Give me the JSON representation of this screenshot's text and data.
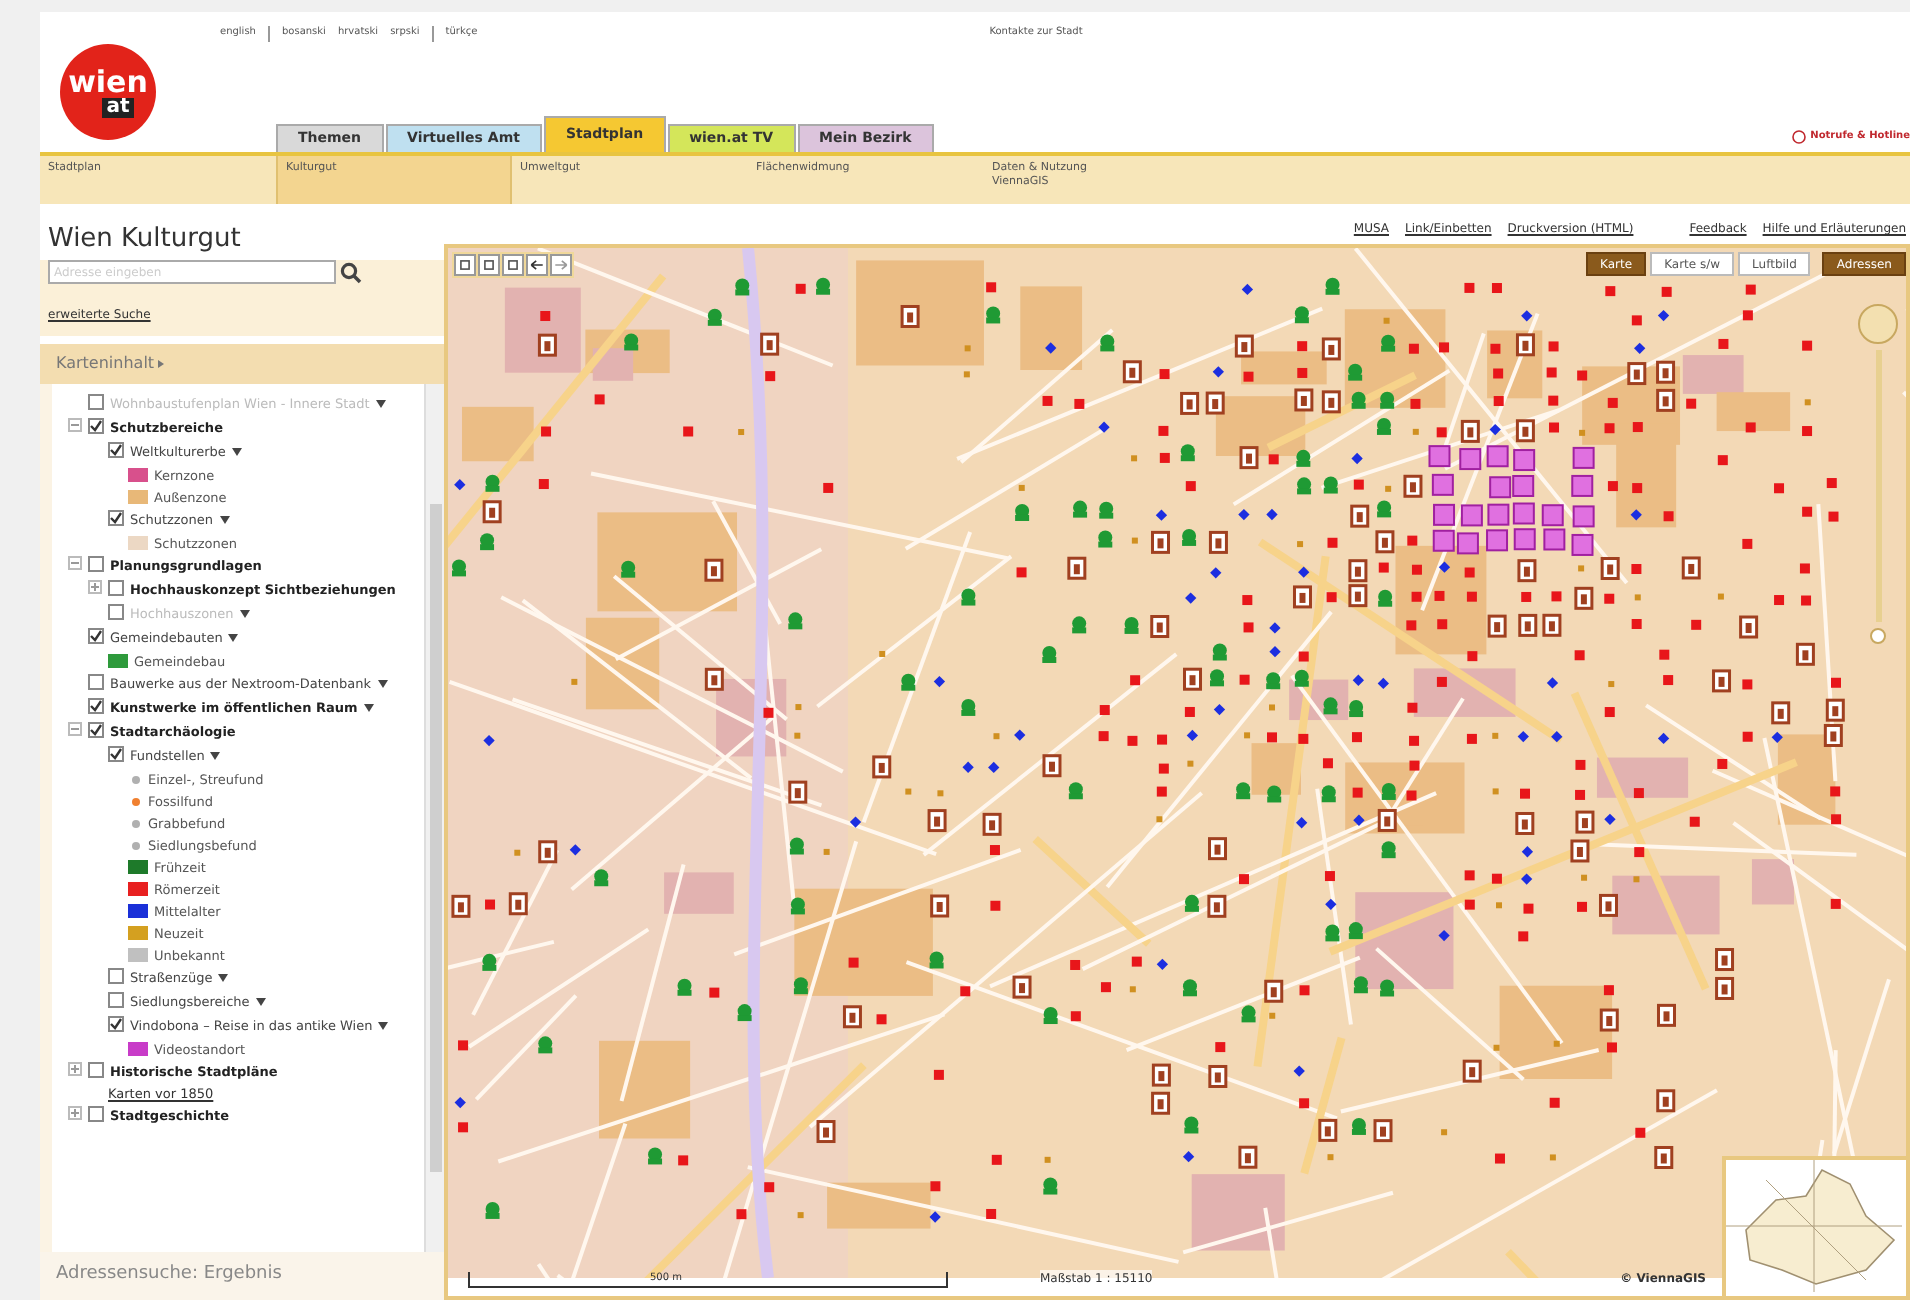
{
  "languages": [
    "english",
    "bosanski",
    "hrvatski",
    "srpski",
    "türkçe"
  ],
  "top_link": "Kontakte zur Stadt",
  "emergency_link": "Notrufe & Hotline",
  "logo": {
    "line1": "wien",
    "line2": "at"
  },
  "tabs": [
    {
      "label": "Themen",
      "color": "#d9d9d9",
      "selected": false
    },
    {
      "label": "Virtuelles Amt",
      "color": "#bfe0f0",
      "selected": false
    },
    {
      "label": "Stadtplan",
      "color": "#f5c832",
      "selected": true
    },
    {
      "label": "wien.at TV",
      "color": "#d4e65a",
      "selected": false
    },
    {
      "label": "Mein Bezirk",
      "color": "#dcc4dc",
      "selected": false
    }
  ],
  "subnav": [
    {
      "lines": [
        "Stadtplan"
      ],
      "selected": false
    },
    {
      "lines": [
        "Kulturgut"
      ],
      "selected": true
    },
    {
      "lines": [
        "Umweltgut"
      ],
      "selected": false
    },
    {
      "lines": [
        "Flächenwidmung"
      ],
      "selected": false
    },
    {
      "lines": [
        "Daten & Nutzung",
        "ViennaGIS"
      ],
      "selected": false
    }
  ],
  "page_title": "Wien Kulturgut",
  "search": {
    "placeholder": "Adresse eingeben",
    "advanced_link": "erweiterte Suche"
  },
  "links": [
    "MUSA",
    "Link/Einbetten",
    "Druckversion (HTML)",
    "Feedback",
    "Hilfe und Erläuterungen"
  ],
  "panel_title": "Karteninhalt",
  "tree": [
    {
      "kind": "layer",
      "label": "Wohnbaustufenplan Wien - Innere Stadt",
      "checked": false,
      "disabled": true,
      "menu": true
    },
    {
      "kind": "group",
      "label": "Schutzbereiche",
      "checked": true,
      "expanded": true,
      "children": [
        {
          "kind": "layer",
          "label": "Weltkulturerbe",
          "checked": true,
          "menu": true,
          "children": [
            {
              "kind": "swatch",
              "label": "Kernzone",
              "color": "#d8508c"
            },
            {
              "kind": "swatch",
              "label": "Außenzone",
              "color": "#e8b878"
            }
          ]
        },
        {
          "kind": "layer",
          "label": "Schutzzonen",
          "checked": true,
          "menu": true,
          "children": [
            {
              "kind": "swatch",
              "label": "Schutzzonen",
              "color": "#ecd8c4"
            }
          ]
        }
      ]
    },
    {
      "kind": "group",
      "label": "Planungsgrundlagen",
      "checked": false,
      "expanded": true,
      "children": [
        {
          "kind": "group",
          "label": "Hochhauskonzept Sichtbeziehungen",
          "checked": false,
          "expanded": false
        },
        {
          "kind": "layer",
          "label": "Hochhauszonen",
          "checked": false,
          "disabled": true,
          "menu": true
        }
      ]
    },
    {
      "kind": "layer",
      "label": "Gemeindebauten",
      "checked": true,
      "menu": true,
      "children": [
        {
          "kind": "swatch",
          "label": "Gemeindebau",
          "color": "#2e9a3c"
        }
      ]
    },
    {
      "kind": "layer",
      "label": "Bauwerke aus der Nextroom-Datenbank",
      "checked": false,
      "menu": true
    },
    {
      "kind": "group",
      "label": "Kunstwerke im öffentlichen Raum",
      "checked": true,
      "menu": true
    },
    {
      "kind": "group",
      "label": "Stadtarchäologie",
      "checked": true,
      "expanded": true,
      "children": [
        {
          "kind": "layer",
          "label": "Fundstellen",
          "checked": true,
          "menu": true,
          "children": [
            {
              "kind": "dot",
              "label": "Einzel-, Streufund",
              "color": "#b0b0b0"
            },
            {
              "kind": "dot",
              "label": "Fossilfund",
              "color": "#f08030"
            },
            {
              "kind": "dot",
              "label": "Grabbefund",
              "color": "#b0b0b0"
            },
            {
              "kind": "dot",
              "label": "Siedlungsbefund",
              "color": "#b0b0b0"
            },
            {
              "kind": "swatch",
              "label": "Frühzeit",
              "color": "#1e7a2a"
            },
            {
              "kind": "swatch",
              "label": "Römerzeit",
              "color": "#e82020"
            },
            {
              "kind": "swatch",
              "label": "Mittelalter",
              "color": "#1a30d8"
            },
            {
              "kind": "swatch",
              "label": "Neuzeit",
              "color": "#d4a020"
            },
            {
              "kind": "swatch",
              "label": "Unbekannt",
              "color": "#c0c0c0"
            }
          ]
        },
        {
          "kind": "layer",
          "label": "Straßenzüge",
          "checked": false,
          "menu": true
        },
        {
          "kind": "layer",
          "label": "Siedlungsbereiche",
          "checked": false,
          "menu": true
        },
        {
          "kind": "layer",
          "label": "Vindobona – Reise in das antike Wien",
          "checked": true,
          "menu": true,
          "children": [
            {
              "kind": "swatch",
              "label": "Videostandort",
              "color": "#c83cc8"
            }
          ]
        }
      ]
    },
    {
      "kind": "group",
      "label": "Historische Stadtpläne",
      "checked": false,
      "expanded": false,
      "children": [
        {
          "kind": "link",
          "label": "Karten vor 1850"
        }
      ]
    },
    {
      "kind": "group",
      "label": "Stadtgeschichte",
      "checked": false,
      "expanded": false
    }
  ],
  "result_panel": "Adressensuche: Ergebnis",
  "map": {
    "layers": [
      {
        "label": "Karte",
        "selected": true
      },
      {
        "label": "Karte s/w",
        "selected": false
      },
      {
        "label": "Luftbild",
        "selected": false
      },
      {
        "label": "Adressen",
        "selected": true
      }
    ],
    "scale": "500 m",
    "scale_ratio": "Maßstab 1 : 15110",
    "copyright": "© ViennaGIS"
  }
}
